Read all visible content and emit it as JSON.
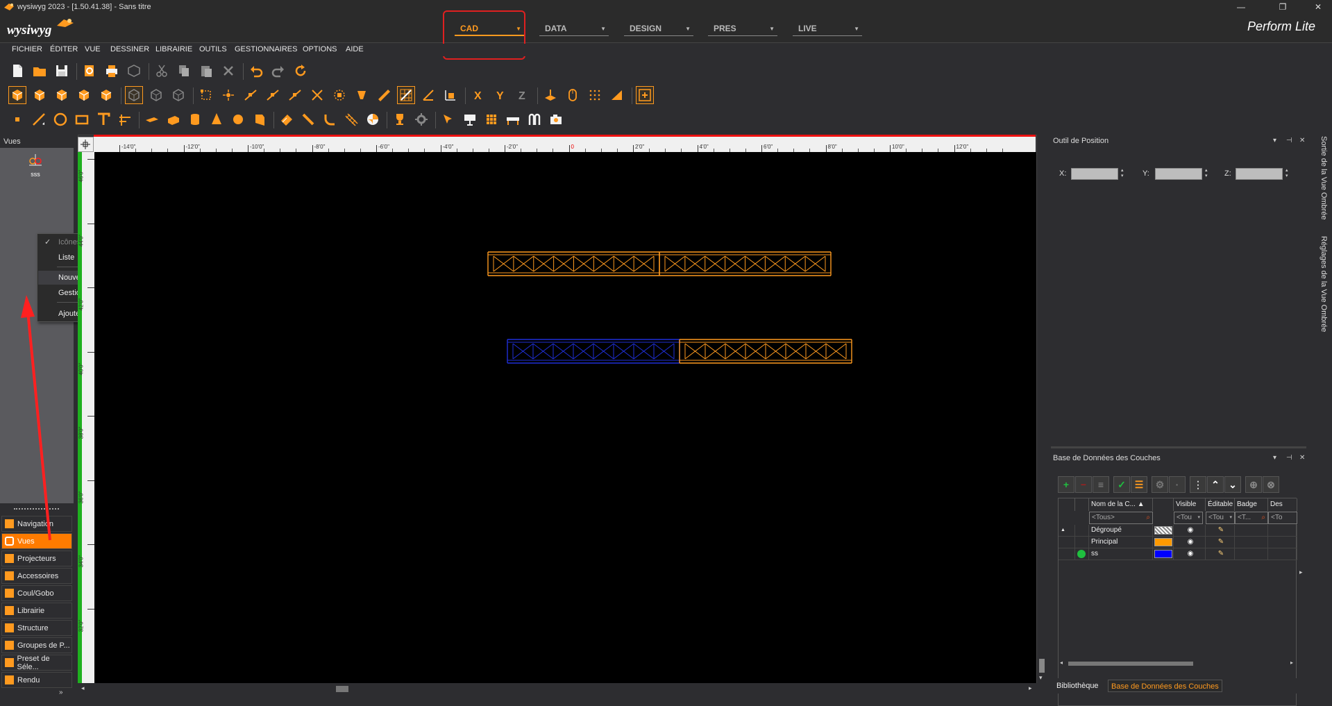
{
  "window": {
    "title": "wysiwyg 2023 - [1.50.41.38] - Sans titre",
    "controls": [
      "—",
      "❐",
      "✕"
    ]
  },
  "header": {
    "logo": "wysiwyg",
    "product": "Perform Lite",
    "modes": [
      {
        "label": "CAD",
        "active": true
      },
      {
        "label": "DATA",
        "active": false
      },
      {
        "label": "DESIGN",
        "active": false
      },
      {
        "label": "PRES",
        "active": false
      },
      {
        "label": "LIVE",
        "active": false
      }
    ],
    "highlight_color": "#e02020"
  },
  "menu": [
    "FICHIER",
    "ÉDITER",
    "VUE",
    "DESSINER",
    "LIBRAIRIE",
    "OUTILS",
    "GESTIONNAIRES",
    "OPTIONS",
    "AIDE"
  ],
  "toolbar_icons": {
    "row1": [
      "new-file-icon",
      "open-folder-icon",
      "save-icon",
      "print-preview-icon",
      "print-icon",
      "package-icon",
      "cut-icon",
      "copy-icon",
      "paste-icon",
      "delete-icon",
      "undo-icon",
      "redo-icon",
      "refresh-icon"
    ],
    "row2": [
      "view-cube-front-icon",
      "view-cube-top-icon",
      "view-cube-side-icon",
      "view-cube-iso-icon",
      "view-cube-persp-icon",
      "view-shaded-icon",
      "view-wire-icon",
      "view-solid-icon",
      "snap-corner-icon",
      "snap-point-icon",
      "snap-mid-icon",
      "snap-line-icon",
      "snap-end-icon",
      "snap-cross-icon",
      "snap-center-icon",
      "snap-magnet-icon",
      "snap-ruler-icon",
      "snap-grid-icon",
      "snap-angle-icon",
      "snap-scale-icon",
      "axis-x-icon",
      "axis-y-icon",
      "axis-z-icon",
      "elevation-icon",
      "mouse-icon",
      "grid-dots-icon",
      "measure-icon",
      "origin-icon"
    ],
    "row3": [
      "point-icon",
      "line-icon",
      "circle-icon",
      "rectangle-icon",
      "text-icon",
      "dimension-icon",
      "plane-icon",
      "box-icon",
      "cylinder-icon",
      "cone-icon",
      "sphere-icon",
      "wedge-icon",
      "eraser-icon",
      "pipe-icon",
      "arc-icon",
      "truss-icon",
      "hazard-icon",
      "trophy-icon",
      "gear-icon",
      "arrow-select-icon",
      "projector-icon",
      "pattern-icon",
      "barricade-icon",
      "bridge-icon",
      "camera-icon"
    ]
  },
  "views_panel": {
    "label": "Vues",
    "items": [
      {
        "label": "sss"
      }
    ]
  },
  "context_menu": {
    "items": [
      {
        "label": "Icônes",
        "checked": true,
        "disabled": true
      },
      {
        "label": "Liste"
      },
      {
        "label": "Nouvelle Vue",
        "highlighted": true
      },
      {
        "label": "Gestion des Raccourcis"
      },
      {
        "label": "Ajouter un Séparateur"
      }
    ]
  },
  "nav_buttons": [
    {
      "label": "Navigation",
      "icon": "star-icon",
      "active": false
    },
    {
      "label": "Vues",
      "icon": "views-icon",
      "active": true
    },
    {
      "label": "Projecteurs",
      "icon": "projector-icon",
      "active": false
    },
    {
      "label": "Accessoires",
      "icon": "accessories-icon",
      "active": false
    },
    {
      "label": "Coul/Gobo",
      "icon": "gobo-icon",
      "active": false
    },
    {
      "label": "Librairie",
      "icon": "library-icon",
      "active": false
    },
    {
      "label": "Structure",
      "icon": "structure-icon",
      "active": false
    },
    {
      "label": "Groupes de P...",
      "icon": "groups-icon",
      "active": false
    },
    {
      "label": "Preset de Séle...",
      "icon": "preset-icon",
      "active": false
    },
    {
      "label": "Rendu",
      "icon": "render-icon",
      "active": false
    }
  ],
  "ruler": {
    "h_labels": [
      "-14'0\"",
      "-12'0\"",
      "-10'0\"",
      "-8'0\"",
      "-6'0\"",
      "-4'0\"",
      "-2'0\"",
      "0",
      "2'0\"",
      "4'0\"",
      "6'0\"",
      "8'0\"",
      "10'0\"",
      "12'0\""
    ],
    "v_labels": [
      "46'0\"",
      "44'0\"",
      "42'0\"",
      "40'0\"",
      "38'0\"",
      "36'0\"",
      "34'0\"",
      "32'0\""
    ]
  },
  "canvas": {
    "trusses": [
      {
        "color": "#ff9a1f",
        "segments": [
          {
            "color": "#ff9a1f",
            "bays": 8
          },
          {
            "color": "#ff9a1f",
            "bays": 8
          }
        ]
      },
      {
        "color": "#ff9a1f",
        "segments": [
          {
            "color": "#1f2fd8",
            "bays": 8
          },
          {
            "color": "#ff9a1f",
            "bays": 8
          }
        ]
      }
    ]
  },
  "position_tool": {
    "title": "Outil de Position",
    "x_label": "X:",
    "y_label": "Y:",
    "z_label": "Z:",
    "x_value": "",
    "y_value": "",
    "z_value": ""
  },
  "layers_panel": {
    "title": "Base de Données des Couches",
    "columns": [
      "Nom de la C...",
      "Visible",
      "Éditable",
      "Badge",
      "Des"
    ],
    "filters": [
      "<Tous>",
      "<Tou",
      "<Tou",
      "<T...",
      "<To"
    ],
    "rows": [
      {
        "name": "Dégroupé",
        "color": "pattern",
        "visible": true,
        "editable": true,
        "expand": "▲",
        "current": false
      },
      {
        "name": "Principal",
        "color": "#ff9a00",
        "visible": true,
        "editable": true,
        "expand": "",
        "current": false
      },
      {
        "name": "ss",
        "color": "#0000ff",
        "visible": true,
        "editable": true,
        "expand": "",
        "current": true
      }
    ]
  },
  "right_tabs": [
    {
      "label": "Bibliothèque",
      "active": false
    },
    {
      "label": "Base de Données des Couches",
      "active": true
    }
  ],
  "side_tabs": [
    "Sortie de la Vue Ombrée",
    "Réglages de la Vue Ombrée"
  ],
  "accent": "#ff9a1f",
  "annotation_color": "#ff2020"
}
